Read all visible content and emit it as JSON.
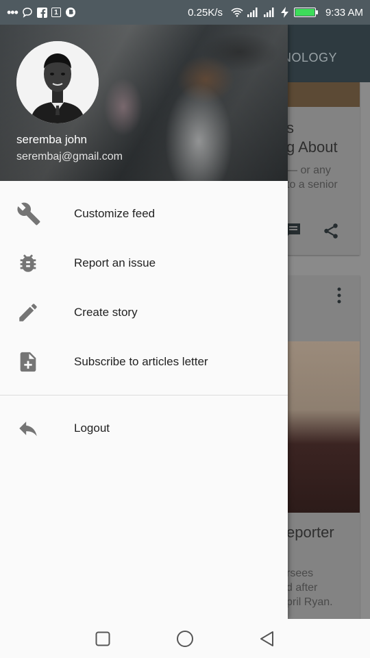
{
  "status_bar": {
    "network_speed": "0.25K/s",
    "time": "9:33 AM",
    "battery_level": 1.0,
    "left_icons": [
      "more-dots-icon",
      "message-icon",
      "facebook-icon",
      "square-icon",
      "browser-icon"
    ],
    "right_icons": [
      "wifi-icon",
      "signal-icon",
      "signal-icon",
      "charging-icon",
      "battery-icon"
    ]
  },
  "background_app": {
    "tab_fragment": "CHNOLOGY",
    "card1": {
      "title_line1": "s",
      "title_line2": "g About",
      "body_line1": "— or any",
      "body_line2": "to a senior"
    },
    "card2": {
      "title": "eporter",
      "body_line1": "rsees",
      "body_line2": "d after",
      "body_line3": "pril Ryan."
    }
  },
  "drawer": {
    "header": {
      "name": "seremba john",
      "email": "serembaj@gmail.com"
    },
    "menu": [
      {
        "label": "Customize feed",
        "icon": "wrench-icon"
      },
      {
        "label": "Report an issue",
        "icon": "bug-icon"
      },
      {
        "label": "Create story",
        "icon": "pencil-icon"
      },
      {
        "label": "Subscribe to articles letter",
        "icon": "note-add-icon"
      }
    ],
    "secondary_menu": [
      {
        "label": "Logout",
        "icon": "reply-icon"
      }
    ]
  },
  "nav_bar": {
    "buttons": [
      "recents-button",
      "home-button",
      "back-button"
    ]
  },
  "colors": {
    "status_bar": "#4f5a60",
    "drawer_bg": "#fafafa",
    "icon_grey": "#757575",
    "text_dark": "#222222"
  }
}
